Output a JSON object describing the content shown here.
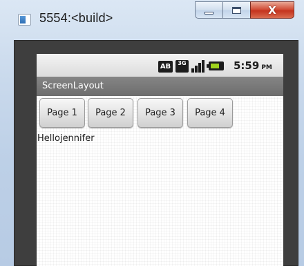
{
  "window": {
    "title": "5554:<build>",
    "icon": "emulator-window-icon",
    "controls": {
      "minimize": "minimize-icon",
      "maximize": "maximize-icon",
      "close": "close-icon",
      "close_glyph": "X"
    }
  },
  "status_bar": {
    "icons": [
      "ab-icon",
      "3g-icon",
      "signal-icon",
      "battery-icon"
    ],
    "ab_text": "AB",
    "network_text": "3G",
    "time": "5:59",
    "ampm": "PM"
  },
  "app": {
    "title": "ScreenLayout",
    "buttons": [
      {
        "label": "Page 1"
      },
      {
        "label": "Page 2"
      },
      {
        "label": "Page 3"
      },
      {
        "label": "Page 4"
      }
    ],
    "label_text": "Hellojennifer"
  },
  "colors": {
    "title_bar": "#c9d9ec",
    "close_button": "#c5331e",
    "emulator_frame": "#3e3e3e",
    "app_bar": "#777777",
    "battery_fill": "#9fd31c"
  }
}
